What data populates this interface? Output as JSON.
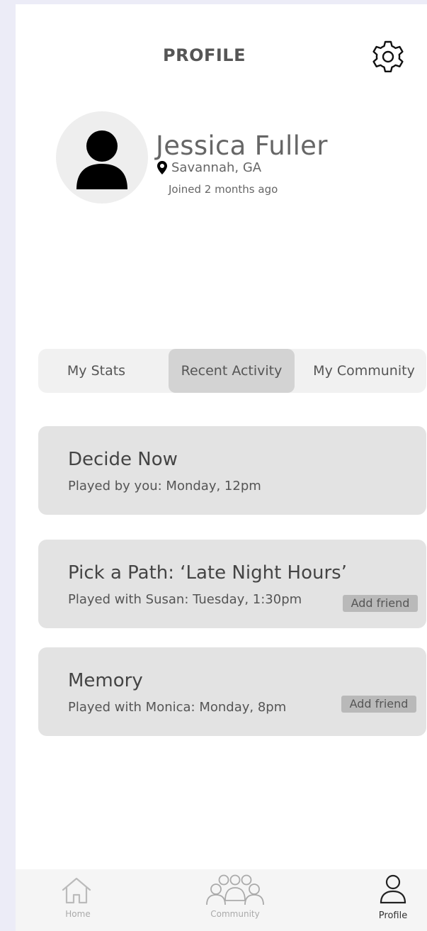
{
  "header": {
    "title": "PROFILE",
    "settings_icon": "gear-icon"
  },
  "profile": {
    "name": "Jessica Fuller",
    "location": "Savannah, GA",
    "joined": "Joined 2 months ago",
    "avatar_icon": "person-icon",
    "location_icon": "map-pin-icon"
  },
  "tabs": [
    {
      "label": "My Stats",
      "selected": false
    },
    {
      "label": "Recent Activity",
      "selected": true
    },
    {
      "label": "My Community",
      "selected": false
    }
  ],
  "activities": [
    {
      "title": "Decide Now",
      "subtitle": "Played by you: Monday, 12pm",
      "add_friend": ""
    },
    {
      "title": "Pick a Path: ‘Late Night Hours’",
      "subtitle": "Played with Susan: Tuesday, 1:30pm",
      "add_friend": "Add friend"
    },
    {
      "title": "Memory",
      "subtitle": "Played with Monica: Monday, 8pm",
      "add_friend": "Add friend"
    }
  ],
  "nav": [
    {
      "label": "Home",
      "icon": "home-icon",
      "active": false
    },
    {
      "label": "Community",
      "icon": "community-icon",
      "active": false
    },
    {
      "label": "Profile",
      "icon": "profile-icon",
      "active": true
    }
  ],
  "colors": {
    "background": "#ececf7",
    "card": "#e3e3e3",
    "tab_selected": "#d3d3d3",
    "add_friend_badge": "#b9b9b9"
  }
}
